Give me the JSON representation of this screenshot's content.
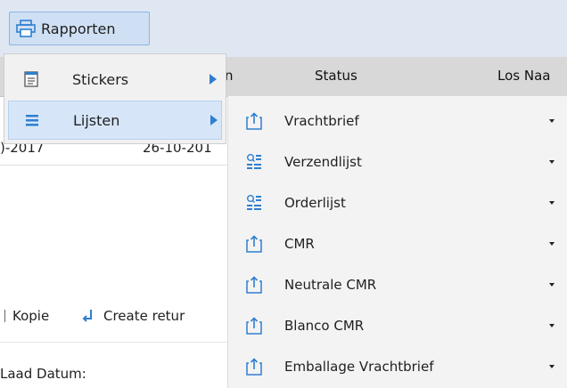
{
  "toolbar": {
    "rapporten_label": "Rapporten"
  },
  "grid": {
    "headers": {
      "col_n": "n",
      "status": "Status",
      "los": "Los Naa"
    },
    "row1": {
      "date1": ")-2017",
      "date2": "26-10-201"
    }
  },
  "actions": {
    "kopie": "Kopie",
    "create_return": "Create retur"
  },
  "form": {
    "laad_datum_label": "Laad Datum:"
  },
  "menu_level1": {
    "items": [
      {
        "label": "Stickers",
        "icon": "stickers-icon"
      },
      {
        "label": "Lijsten",
        "icon": "list-icon"
      }
    ]
  },
  "menu_level2": {
    "items": [
      {
        "label": "Vrachtbrief",
        "icon": "document-export-icon"
      },
      {
        "label": "Verzendlijst",
        "icon": "search-list-icon"
      },
      {
        "label": "Orderlijst",
        "icon": "search-list-icon"
      },
      {
        "label": "CMR",
        "icon": "document-export-icon"
      },
      {
        "label": "Neutrale CMR",
        "icon": "document-export-icon"
      },
      {
        "label": "Blanco CMR",
        "icon": "document-export-icon"
      },
      {
        "label": "Emballage Vrachtbrief",
        "icon": "document-export-icon"
      }
    ]
  },
  "colors": {
    "accent": "#2f7fd0",
    "toolbar_bg": "#dfe7f2",
    "selected_bg": "#d6e6f8",
    "header_bg": "#d8d8d8"
  }
}
